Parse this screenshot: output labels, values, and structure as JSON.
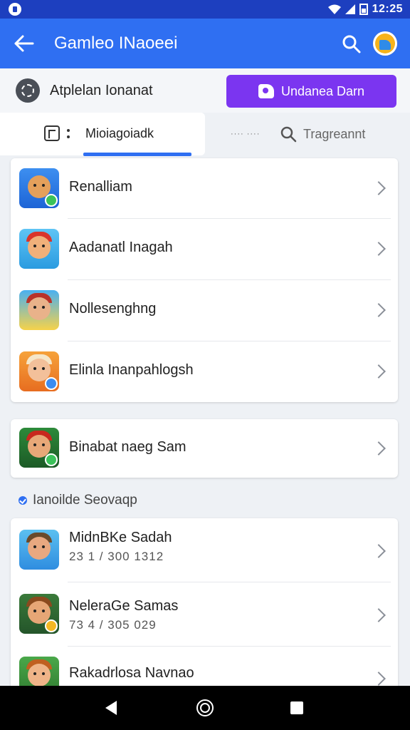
{
  "status_bar": {
    "time": "12:25"
  },
  "app_bar": {
    "title": "Gamleo INaoeei"
  },
  "account": {
    "label": "Atplelan Ionanat"
  },
  "primary_action": {
    "label": "Undanea Darn"
  },
  "tabs": [
    {
      "label": "Mioiagoiadk",
      "active": true
    },
    {
      "small_text": "···· ····",
      "label": "Tragreannt",
      "active": false
    }
  ],
  "list_card_1": {
    "items": [
      {
        "title": "Renalliam",
        "icon": "character-icon-acorn"
      },
      {
        "title": "Aadanatl Inagah",
        "icon": "character-icon-red-hood"
      },
      {
        "title": "Nollesenghng",
        "icon": "character-icon-pirate"
      },
      {
        "title": "Elinla Inanpahlogsh",
        "icon": "character-icon-girl"
      }
    ]
  },
  "list_card_2": {
    "items": [
      {
        "title": "Binabat naeg Sam",
        "icon": "character-icon-red-hat"
      }
    ]
  },
  "section": {
    "title": "Ianoilde Seovaqp"
  },
  "list_card_3": {
    "items": [
      {
        "title": "MidnBKe Sadah",
        "subtitle": "23 1 / 300 1312",
        "icon": "character-icon-warrior"
      },
      {
        "title": "NeleraGe Samas",
        "subtitle": "73 4 / 305 029",
        "icon": "character-icon-hat-boy"
      },
      {
        "title": "Rakadrlosa Navnao",
        "subtitle": "",
        "icon": "character-icon-elf"
      }
    ]
  },
  "colors": {
    "status_bar": "#1d3fbf",
    "app_bar": "#2f6ff2",
    "primary_button": "#7b35f0",
    "background": "#eef1f5"
  }
}
